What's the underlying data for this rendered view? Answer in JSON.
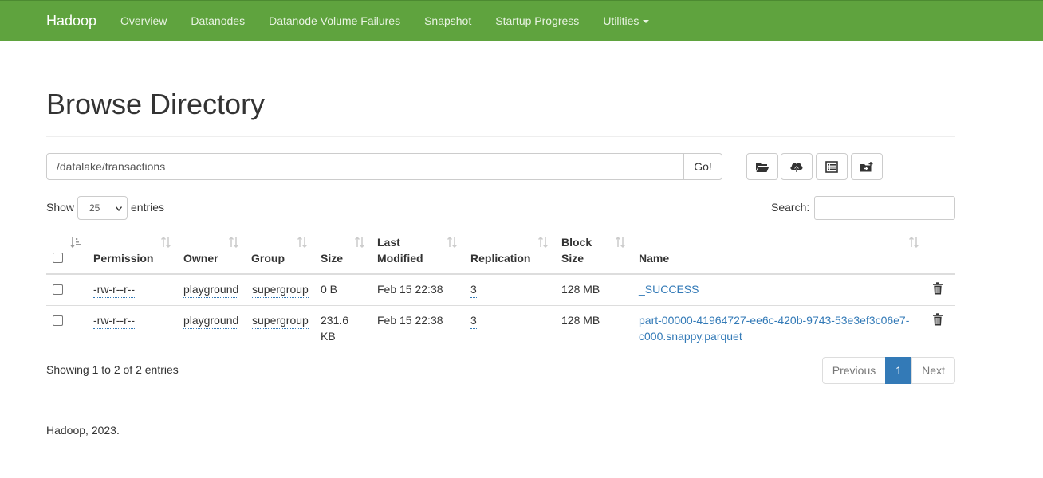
{
  "navbar": {
    "brand": "Hadoop",
    "links": [
      "Overview",
      "Datanodes",
      "Datanode Volume Failures",
      "Snapshot",
      "Startup Progress",
      "Utilities"
    ]
  },
  "page": {
    "title": "Browse Directory"
  },
  "path": {
    "value": "/datalake/transactions",
    "go_label": "Go!"
  },
  "toolbar": {
    "icons": [
      "folder-open-icon",
      "cloud-upload-icon",
      "list-alt-icon",
      "new-folder-icon"
    ]
  },
  "controls": {
    "show_label": "Show",
    "entries_value": "25",
    "entries_label": "entries",
    "search_label": "Search:"
  },
  "table": {
    "columns": [
      "Permission",
      "Owner",
      "Group",
      "Size",
      "Last",
      "Modified",
      "Replication",
      "Block",
      "Size",
      "Name"
    ],
    "rows": [
      {
        "permission": "-rw-r--r--",
        "owner": "playground",
        "group": "supergroup",
        "size_line1": "0 B",
        "size_line2": "",
        "modified": "Feb 15 22:38",
        "replication": "3",
        "block_size": "128 MB",
        "name_line1": "_SUCCESS",
        "name_line2": ""
      },
      {
        "permission": "-rw-r--r--",
        "owner": "playground",
        "group": "supergroup",
        "size_line1": "231.6",
        "size_line2": "KB",
        "modified": "Feb 15 22:38",
        "replication": "3",
        "block_size": "128 MB",
        "name_line1": "part-00000-41964727-ee6c-420b-9743-53e3ef3c06e7-",
        "name_line2": "c000.snappy.parquet"
      }
    ]
  },
  "status": "Showing 1 to 2 of 2 entries",
  "pagination": {
    "previous": "Previous",
    "current": "1",
    "next": "Next"
  },
  "footer": "Hadoop, 2023.",
  "colors": {
    "navbar": "#5fa33e",
    "link": "#337ab7",
    "active_page": "#337ab7"
  }
}
